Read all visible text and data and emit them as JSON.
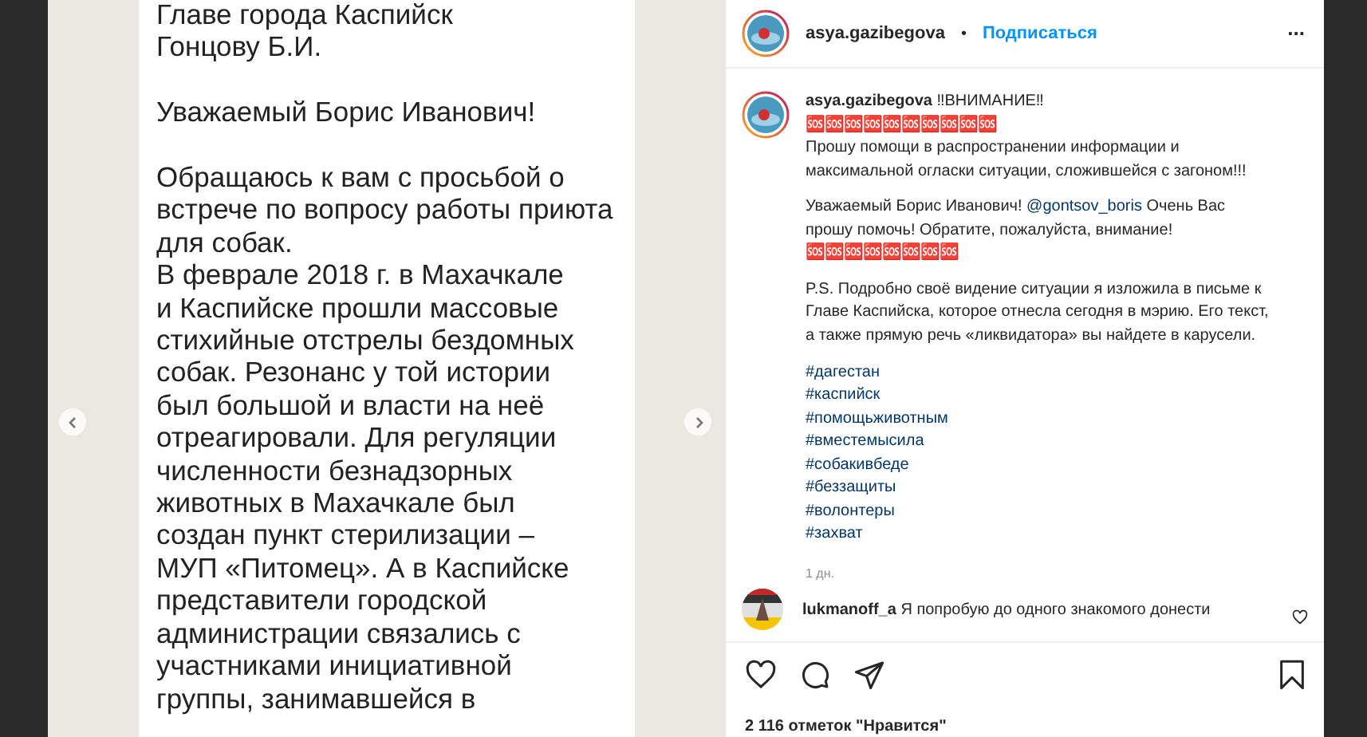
{
  "photo": {
    "paragraphs": [
      [
        "Главе города Каспийск",
        "Гонцову Б.И."
      ],
      [
        "Уважаемый Борис Иванович!"
      ],
      [
        "Обращаюсь к вам с просьбой о",
        "встрече по вопросу работы приюта",
        "для собак.",
        "В феврале 2018 г. в Махачкале",
        "и Каспийске прошли массовые",
        "стихийные отстрелы бездомных",
        "собак. Резонанс у той истории",
        "был большой и власти на неё",
        "отреагировали. Для регуляции",
        "численности безнадзорных",
        "животных в Махачкале был",
        "создан пункт стерилизации –",
        "МУП «Питомец». А в Каспийске",
        "представители городской",
        "администрации связались с",
        "участниками инициативной",
        "группы, занимавшейся в"
      ]
    ]
  },
  "header": {
    "username": "asya.gazibegova",
    "separator": "•",
    "follow": "Подписаться",
    "more": "..."
  },
  "caption": {
    "username": "asya.gazibegova",
    "title": "‼ВНИМАНИЕ‼",
    "blocks": [
      {
        "kind": "text",
        "text": "🆘🆘🆘🆘🆘🆘🆘🆘🆘🆘"
      },
      {
        "kind": "text",
        "text": "Прошу помощи в распространении информации и максимальной огласки ситуации, сложившейся с загоном!!!"
      },
      {
        "kind": "gap"
      },
      {
        "kind": "mention",
        "before": "Уважаемый Борис Иванович! ",
        "mention": "@gontsov_boris",
        "after": " Очень Вас прошу помочь! Обратите, пожалуйста, внимание!"
      },
      {
        "kind": "text",
        "text": "🆘🆘🆘🆘🆘🆘🆘🆘"
      },
      {
        "kind": "gap"
      },
      {
        "kind": "text",
        "text": "P.S. Подробно своё видение ситуации я изложила в письме к Главе Каспийска, которое отнесла сегодня в мэрию. Его текст, а также прямую речь «ликвидатора» вы найдете в карусели."
      },
      {
        "kind": "gap"
      },
      {
        "kind": "hashtag",
        "text": "#дагестан"
      },
      {
        "kind": "hashtag",
        "text": "#каспийск"
      },
      {
        "kind": "hashtag",
        "text": "#помощьживотным"
      },
      {
        "kind": "hashtag",
        "text": "#вместемысила"
      },
      {
        "kind": "hashtag",
        "text": "#собакивбеде"
      },
      {
        "kind": "hashtag",
        "text": "#беззащиты"
      },
      {
        "kind": "hashtag",
        "text": "#волонтеры"
      },
      {
        "kind": "hashtag",
        "text": "#захват"
      }
    ],
    "time": "1 дн."
  },
  "comments": [
    {
      "username": "lukmanoff_a",
      "text": "Я попробую до одного знакомого донести"
    }
  ],
  "likes": "2 116 отметок \"Нравится\""
}
